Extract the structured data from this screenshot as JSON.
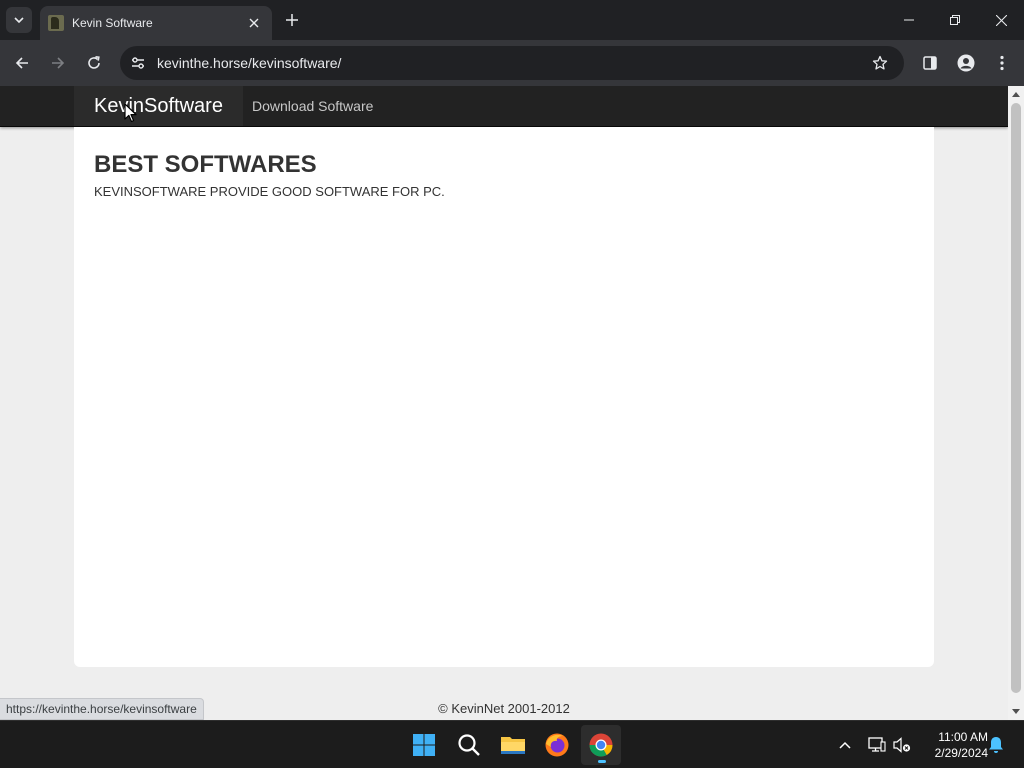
{
  "browser": {
    "tab_title": "Kevin Software",
    "url": "kevinthe.horse/kevinsoftware/",
    "status_url": "https://kevinthe.horse/kevinsoftware"
  },
  "site": {
    "brand": "KevinSoftware",
    "nav_links": [
      "Download Software"
    ],
    "heading": "BEST SOFTWARES",
    "subtext": "KEVINSOFTWARE PROVIDE GOOD SOFTWARE FOR PC.",
    "footer": "© KevinNet 2001-2012"
  },
  "taskbar": {
    "time": "11:00 AM",
    "date": "2/29/2024",
    "apps": [
      "start-icon",
      "search-icon",
      "file-explorer-icon",
      "firefox-icon",
      "chrome-icon"
    ]
  },
  "colors": {
    "chrome_dark": "#202124",
    "chrome_toolbar": "#35363a",
    "site_nav": "#222222",
    "page_bg": "#eeeeee",
    "accent": "#4cc2ff"
  }
}
